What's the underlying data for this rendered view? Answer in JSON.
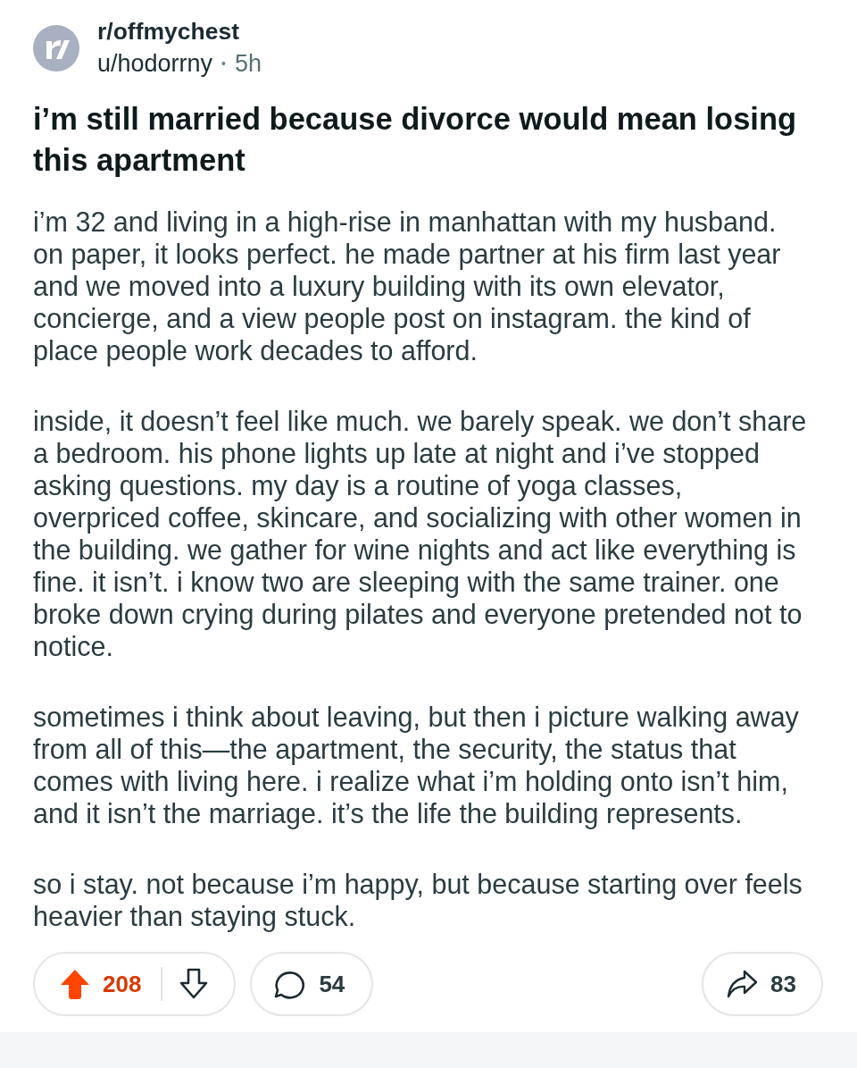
{
  "post": {
    "subreddit": "r/offmychest",
    "author": "u/hodorrny",
    "separator": "•",
    "age": "5h",
    "title": "i’m still married because divorce would mean losing this apartment",
    "paragraphs": [
      "i’m 32 and living in a high-rise in manhattan with my husband. on paper, it looks perfect. he made partner at his firm last year and we moved into a luxury building with its own elevator, concierge, and a view people post on instagram. the kind of place people work decades to afford.",
      "inside, it doesn’t feel like much. we barely speak. we don’t share a bedroom. his phone lights up late at night and i’ve stopped asking questions. my day is a routine of yoga classes, overpriced coffee, skincare, and socializing with other women in the building. we gather for wine nights and act like everything is fine. it isn’t. i know two are sleeping with the same trainer. one broke down crying during pilates and everyone pretended not to notice.",
      "sometimes i think about leaving, but then i picture walking away from all of this—the apartment, the security, the status that comes with living here. i realize what i’m holding onto isn’t him, and it isn’t the marriage. it’s the life the building represents.",
      "so i stay. not because i’m happy, but because starting over feels heavier than staying stuck."
    ]
  },
  "actions": {
    "vote": {
      "score": "208",
      "upvoted": true
    },
    "comments": {
      "count": "54"
    },
    "shares": {
      "count": "83"
    }
  }
}
